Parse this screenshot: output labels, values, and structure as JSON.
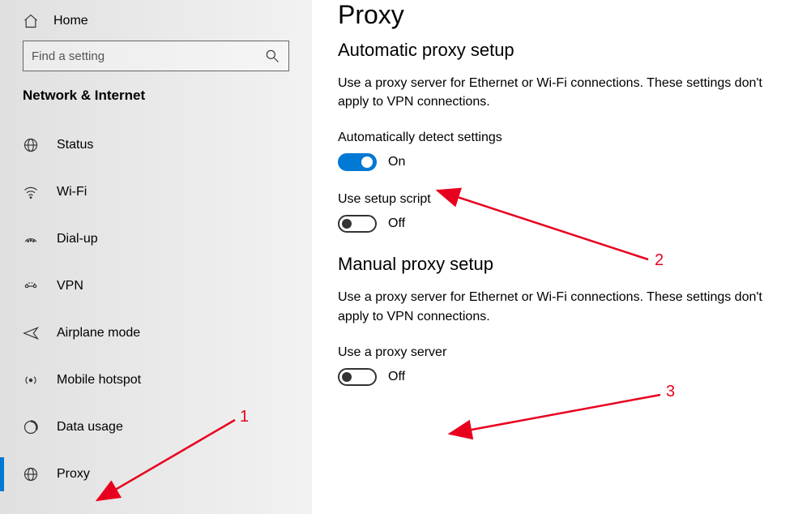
{
  "sidebar": {
    "home": "Home",
    "search_placeholder": "Find a setting",
    "category": "Network & Internet",
    "items": [
      {
        "id": "status",
        "label": "Status"
      },
      {
        "id": "wifi",
        "label": "Wi-Fi"
      },
      {
        "id": "dialup",
        "label": "Dial-up"
      },
      {
        "id": "vpn",
        "label": "VPN"
      },
      {
        "id": "airplane",
        "label": "Airplane mode"
      },
      {
        "id": "hotspot",
        "label": "Mobile hotspot"
      },
      {
        "id": "datausage",
        "label": "Data usage"
      },
      {
        "id": "proxy",
        "label": "Proxy"
      }
    ]
  },
  "main": {
    "title": "Proxy",
    "auto": {
      "heading": "Automatic proxy setup",
      "desc": "Use a proxy server for Ethernet or Wi-Fi connections. These settings don't apply to VPN connections.",
      "detect_label": "Automatically detect settings",
      "detect_state": "On",
      "script_label": "Use setup script",
      "script_state": "Off"
    },
    "manual": {
      "heading": "Manual proxy setup",
      "desc": "Use a proxy server for Ethernet or Wi-Fi connections. These settings don't apply to VPN connections.",
      "use_label": "Use a proxy server",
      "use_state": "Off"
    }
  },
  "annotations": {
    "n1": "1",
    "n2": "2",
    "n3": "3"
  }
}
